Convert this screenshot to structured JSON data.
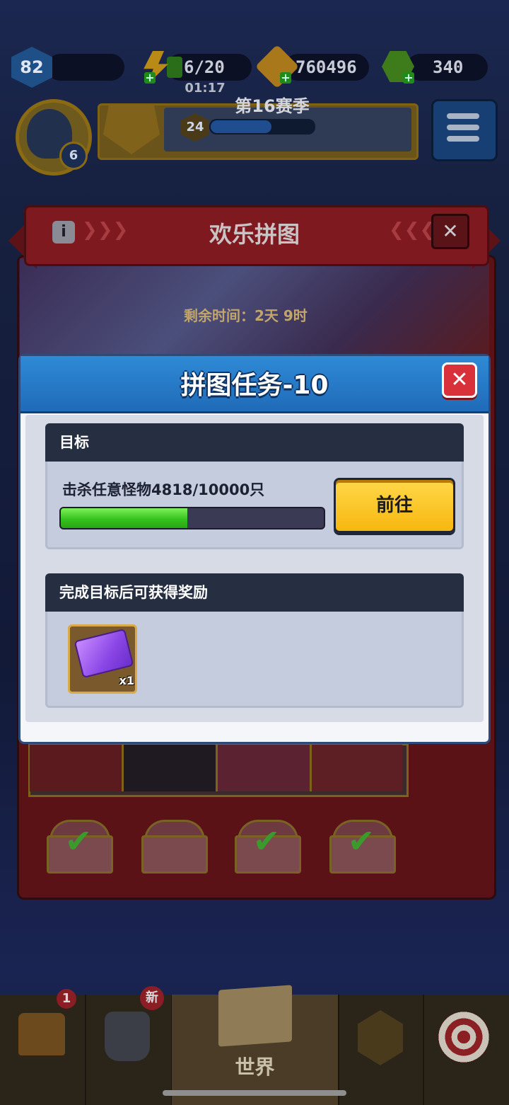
{
  "hud": {
    "player_level": "82",
    "energy": "6/20",
    "energy_timer": "01:17",
    "gold": "760496",
    "gems": "340",
    "avatar_level": "6"
  },
  "season": {
    "title": "第16赛季",
    "level": "24"
  },
  "event": {
    "title": "欢乐拼图",
    "remaining_time": "剩余时间：2天 9时",
    "info_icon": "info-icon",
    "close_icon": "close-icon"
  },
  "modal": {
    "title": "拼图任务-10",
    "close_icon": "close-icon",
    "goal_section_title": "目标",
    "goal_text": "击杀任意怪物4818/10000只",
    "goal_progress": {
      "current": 4818,
      "total": 10000
    },
    "go_button": "前往",
    "reward_section_title": "完成目标后可获得奖励",
    "reward_item": {
      "icon": "puzzle-ticket-icon",
      "quantity": "x1"
    }
  },
  "nav": {
    "tabs": [
      {
        "icon": "chest-icon",
        "badge": "1"
      },
      {
        "icon": "armor-icon",
        "badge": "新"
      },
      {
        "icon": "map-icon",
        "label": "世界"
      },
      {
        "icon": "upgrade-arrow-icon"
      },
      {
        "icon": "target-icon"
      }
    ]
  },
  "colors": {
    "modal_header": "#1f6bb8",
    "progress_fill": "#36c21e",
    "go_button": "#f7b70f",
    "close_button": "#d8313a"
  }
}
